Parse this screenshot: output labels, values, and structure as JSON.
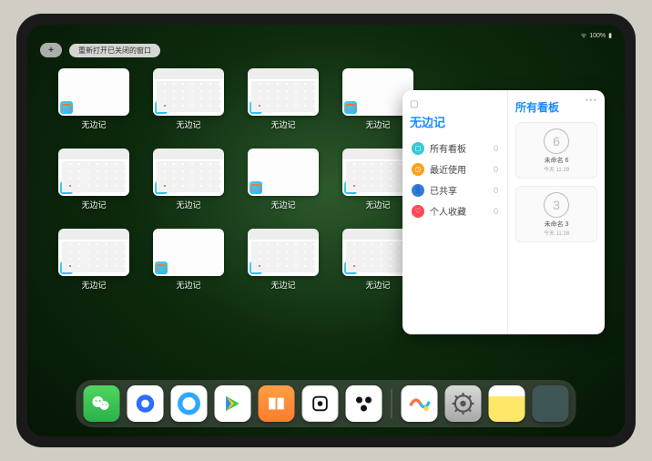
{
  "status": {
    "time": "",
    "battery": "100%"
  },
  "topbar": {
    "plus": "+",
    "reopen": "重新打开已关闭的窗口"
  },
  "app_name": "无边记",
  "thumbs": [
    {
      "label": "无边记",
      "style": "blank"
    },
    {
      "label": "无边记",
      "style": "grid"
    },
    {
      "label": "无边记",
      "style": "grid"
    },
    {
      "label": "无边记",
      "style": "blank"
    },
    {
      "label": "无边记",
      "style": "grid"
    },
    {
      "label": "无边记",
      "style": "grid"
    },
    {
      "label": "无边记",
      "style": "blank"
    },
    {
      "label": "无边记",
      "style": "grid"
    },
    {
      "label": "无边记",
      "style": "grid"
    },
    {
      "label": "无边记",
      "style": "blank"
    },
    {
      "label": "无边记",
      "style": "grid"
    },
    {
      "label": "无边记",
      "style": "grid"
    }
  ],
  "panel": {
    "title": "无边记",
    "right_title": "所有看板",
    "more": "•••",
    "categories": [
      {
        "name": "所有看板",
        "count": "0",
        "color": "#38c8d6",
        "glyph": "◻"
      },
      {
        "name": "最近使用",
        "count": "0",
        "color": "#ff9f1a",
        "glyph": "◷"
      },
      {
        "name": "已共享",
        "count": "0",
        "color": "#3a7bd5",
        "glyph": "👤"
      },
      {
        "name": "个人收藏",
        "count": "0",
        "color": "#ff4757",
        "glyph": "♡"
      }
    ],
    "boards": [
      {
        "sketch": "6",
        "name": "未命名 6",
        "time": "今天 11:29"
      },
      {
        "sketch": "3",
        "name": "未命名 3",
        "time": "今天 11:28"
      }
    ]
  },
  "dock": {
    "items": [
      {
        "name": "wechat-icon"
      },
      {
        "name": "qqhd-icon"
      },
      {
        "name": "qqbrowser-icon"
      },
      {
        "name": "play-icon"
      },
      {
        "name": "books-icon"
      },
      {
        "name": "dice-icon"
      },
      {
        "name": "atoms-icon"
      },
      {
        "name": "freeform-icon"
      },
      {
        "name": "settings-icon"
      },
      {
        "name": "notes-icon"
      },
      {
        "name": "app-library-icon"
      }
    ]
  }
}
